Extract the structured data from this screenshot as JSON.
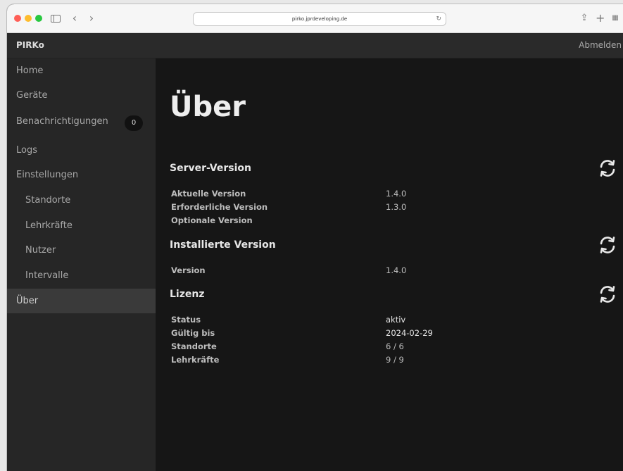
{
  "browser": {
    "url": "pirko.jprdeveloping.de"
  },
  "app": {
    "brand": "PIRKo",
    "logout": "Abmelden"
  },
  "sidebar": {
    "items": [
      {
        "label": "Home"
      },
      {
        "label": "Geräte"
      },
      {
        "label": "Benachrichtigungen",
        "badge": "0"
      },
      {
        "label": "Logs"
      },
      {
        "label": "Einstellungen"
      },
      {
        "label": "Standorte"
      },
      {
        "label": "Lehrkräfte"
      },
      {
        "label": "Nutzer"
      },
      {
        "label": "Intervalle"
      },
      {
        "label": "Über",
        "active": true
      }
    ]
  },
  "main": {
    "title": "Über",
    "server": {
      "title": "Server-Version",
      "rows": [
        {
          "label": "Aktuelle Version",
          "value": "1.4.0"
        },
        {
          "label": "Erforderliche Version",
          "value": "1.3.0"
        },
        {
          "label": "Optionale Version",
          "value": ""
        }
      ]
    },
    "installed": {
      "title": "Installierte Version",
      "rows": [
        {
          "label": "Version",
          "value": "1.4.0"
        }
      ]
    },
    "license": {
      "title": "Lizenz",
      "rows": [
        {
          "label": "Status",
          "value": "aktiv"
        },
        {
          "label": "Gültig bis",
          "value": "2024-02-29"
        },
        {
          "label": "Standorte",
          "value": "6 / 6"
        },
        {
          "label": "Lehrkräfte",
          "value": "9 / 9"
        }
      ]
    }
  },
  "icons": {
    "refresh": "refresh-icon"
  },
  "colors": {
    "sidebar_bg": "#262626",
    "main_bg": "#161616",
    "active_item": "#3a3a3a"
  }
}
